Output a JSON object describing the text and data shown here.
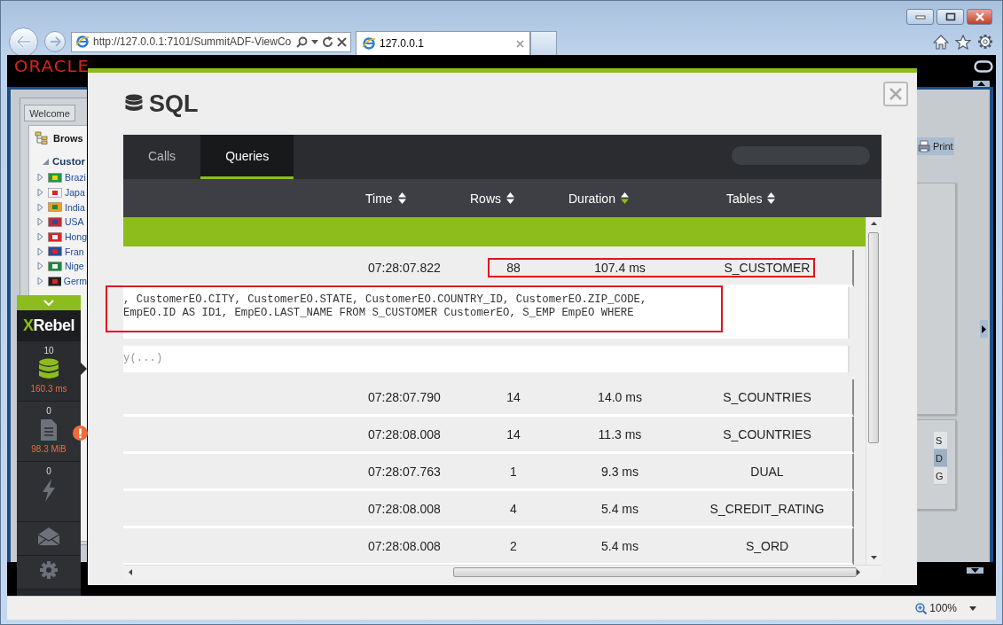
{
  "browser": {
    "address": "http://127.0.0.1:7101/SummitADF-ViewCo",
    "tabs": [
      {
        "label": "127.0.0.1",
        "selected": true
      }
    ],
    "zoom": "100%"
  },
  "app": {
    "logo": "ORACLE",
    "left_panel": {
      "tab": "Welcome",
      "header": "Brows",
      "group": {
        "label": "Custor",
        "expanded": true
      },
      "items": [
        {
          "label": "Brazi",
          "expanded": false
        },
        {
          "label": "Japa",
          "expanded": false
        },
        {
          "label": "India",
          "expanded": false
        },
        {
          "label": "USA",
          "expanded": false
        },
        {
          "label": "Hong",
          "expanded": false
        },
        {
          "label": "Fran",
          "expanded": false
        },
        {
          "label": "Nige",
          "expanded": false
        },
        {
          "label": "Germ",
          "expanded": false
        }
      ]
    },
    "right_panel": {
      "button": "Print",
      "cells": [
        {
          "text": "S",
          "selected": false
        },
        {
          "text": "D",
          "selected": true
        },
        {
          "text": "G",
          "selected": false
        }
      ]
    }
  },
  "modal": {
    "title": "SQL",
    "tabs": [
      {
        "label": "Calls",
        "selected": false
      },
      {
        "label": "Queries",
        "selected": true
      }
    ],
    "columns": [
      {
        "label": "Time",
        "sorted": false
      },
      {
        "label": "Rows",
        "sorted": false
      },
      {
        "label": "Duration",
        "sorted": true
      },
      {
        "label": "Tables",
        "sorted": false
      }
    ],
    "rows": [
      {
        "kind": "query",
        "time": "07:28:07.822",
        "rows": "88",
        "duration": "107.4 ms",
        "tables": "S_CUSTOMER",
        "highlighted": true
      },
      {
        "kind": "detail",
        "lines": [
          ", CustomerEO.CITY, CustomerEO.STATE, CustomerEO.COUNTRY_ID, CustomerEO.ZIP_CODE,",
          "EmpEO.ID AS ID1, EmpEO.LAST_NAME FROM S_CUSTOMER CustomerEO, S_EMP EmpEO WHERE"
        ],
        "highlighted": true,
        "dimmed": false
      },
      {
        "kind": "detail",
        "lines": [
          "y(...)"
        ],
        "highlighted": false,
        "dimmed": true
      },
      {
        "kind": "query",
        "time": "07:28:07.790",
        "rows": "14",
        "duration": "14.0 ms",
        "tables": "S_COUNTRIES",
        "highlighted": false
      },
      {
        "kind": "query",
        "time": "07:28:08.008",
        "rows": "14",
        "duration": "11.3 ms",
        "tables": "S_COUNTRIES",
        "highlighted": false
      },
      {
        "kind": "query",
        "time": "07:28:07.763",
        "rows": "1",
        "duration": "9.3 ms",
        "tables": "DUAL",
        "highlighted": false
      },
      {
        "kind": "query",
        "time": "07:28:08.008",
        "rows": "4",
        "duration": "5.4 ms",
        "tables": "S_CREDIT_RATING",
        "highlighted": false
      },
      {
        "kind": "query",
        "time": "07:28:08.008",
        "rows": "2",
        "duration": "5.4 ms",
        "tables": "S_ORD",
        "highlighted": false
      }
    ]
  },
  "xrebel": {
    "logo": "XRebel",
    "sections": [
      {
        "kind": "database",
        "count": "10",
        "reading": "160.3 ms",
        "selected": true,
        "alert": false
      },
      {
        "kind": "document",
        "count": "0",
        "reading": "98.3 MiB",
        "selected": false,
        "alert": true
      },
      {
        "kind": "bolt",
        "count": "0",
        "selected": false,
        "alert": false
      },
      {
        "kind": "mail",
        "selected": false,
        "alert": false
      },
      {
        "kind": "settings",
        "selected": false,
        "alert": false
      }
    ]
  }
}
